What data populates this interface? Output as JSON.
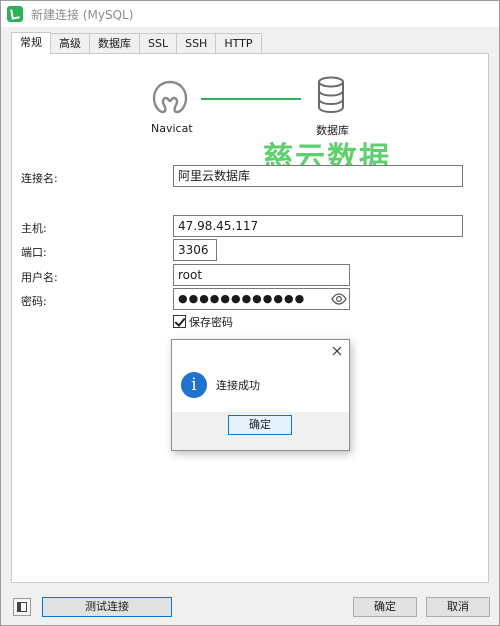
{
  "window": {
    "title": "新建连接 (MySQL)"
  },
  "tabs": [
    {
      "label": "常规",
      "active": true
    },
    {
      "label": "高级"
    },
    {
      "label": "数据库"
    },
    {
      "label": "SSL"
    },
    {
      "label": "SSH"
    },
    {
      "label": "HTTP"
    }
  ],
  "diagram": {
    "left_label": "Navicat",
    "right_label": "数据库",
    "line_color": "#2fb15a"
  },
  "watermark": "慈云数据",
  "form": {
    "connection_name": {
      "label": "连接名:",
      "value": "阿里云数据库"
    },
    "host": {
      "label": "主机:",
      "value": "47.98.45.117"
    },
    "port": {
      "label": "端口:",
      "value": "3306"
    },
    "username": {
      "label": "用户名:",
      "value": "root"
    },
    "password": {
      "label": "密码:",
      "value": "●●●●●●●●●●●●"
    },
    "save_password": {
      "label": "保存密码",
      "checked": true
    }
  },
  "dialog": {
    "message": "连接成功",
    "ok_label": "确定"
  },
  "footer": {
    "test_label": "测试连接",
    "ok_label": "确定",
    "cancel_label": "取消"
  },
  "colors": {
    "accent": "#0078d7",
    "brand": "#2fb15a",
    "info": "#1f73cf"
  }
}
